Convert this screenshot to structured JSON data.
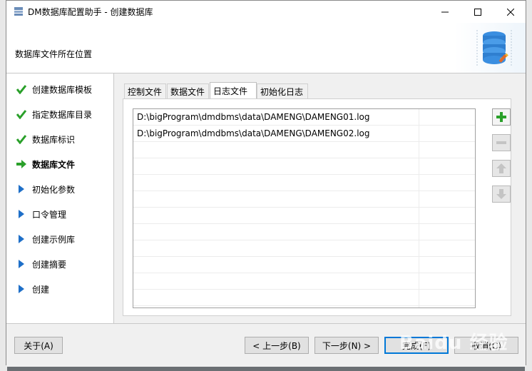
{
  "window": {
    "title": "DM数据库配置助手 - 创建数据库",
    "header_title": "数据库文件所在位置"
  },
  "steps": [
    {
      "label": "创建数据库模板",
      "status": "done"
    },
    {
      "label": "指定数据库目录",
      "status": "done"
    },
    {
      "label": "数据库标识",
      "status": "done"
    },
    {
      "label": "数据库文件",
      "status": "current"
    },
    {
      "label": "初始化参数",
      "status": "pending"
    },
    {
      "label": "口令管理",
      "status": "pending"
    },
    {
      "label": "创建示例库",
      "status": "pending"
    },
    {
      "label": "创建摘要",
      "status": "pending"
    },
    {
      "label": "创建",
      "status": "pending"
    }
  ],
  "tabs": [
    "控制文件",
    "数据文件",
    "日志文件",
    "初始化日志"
  ],
  "active_tab": "日志文件",
  "log_files": [
    "D:\\bigProgram\\dmdbms\\data\\DAMENG\\DAMENG01.log",
    "D:\\bigProgram\\dmdbms\\data\\DAMENG\\DAMENG02.log"
  ],
  "footer": {
    "about": "关于(A)",
    "prev": "< 上一步(B)",
    "next": "下一步(N) >",
    "finish": "完成(F)",
    "cancel": "取消(C)"
  },
  "watermark": "Baidu 经验",
  "colors": {
    "accent": "#0078d7",
    "done": "#2aa02a",
    "pending": "#1e6fc8"
  }
}
